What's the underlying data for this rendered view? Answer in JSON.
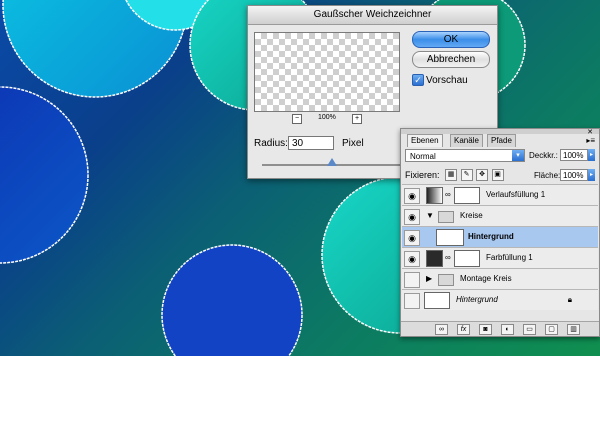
{
  "colors": {
    "accent": "#3b8ee8",
    "selected_row": "#a9c8f0"
  },
  "blur_dialog": {
    "title": "Gaußscher Weichzeichner",
    "ok_label": "OK",
    "cancel_label": "Abbrechen",
    "preview_label": "Vorschau",
    "preview_checked": true,
    "zoom_minus": "−",
    "zoom_plus": "+",
    "zoom_value": "100%",
    "radius_label": "Radius:",
    "radius_value": "30",
    "radius_unit": "Pixel",
    "slider_fraction": 0.32
  },
  "layers_panel": {
    "tabs": [
      {
        "label": "Ebenen",
        "active": true
      },
      {
        "label": "Kanäle",
        "active": false
      },
      {
        "label": "Pfade",
        "active": false
      }
    ],
    "blend_mode": "Normal",
    "opacity_label": "Deckkr.:",
    "opacity_value": "100%",
    "lock_label": "Fixieren:",
    "fill_label": "Fläche:",
    "fill_value": "100%",
    "layers": [
      {
        "name": "Verlaufsfüllung 1",
        "visible": true,
        "type": "gradient-fill"
      },
      {
        "name": "Kreise",
        "visible": true,
        "type": "group",
        "expanded": true
      },
      {
        "name": "Hintergrund",
        "visible": true,
        "type": "layer",
        "selected": true
      },
      {
        "name": "Farbfüllung 1",
        "visible": true,
        "type": "color-fill"
      },
      {
        "name": "Montage Kreis",
        "visible": false,
        "type": "group",
        "expanded": false
      },
      {
        "name": "Hintergrund",
        "visible": false,
        "type": "background",
        "locked": true
      }
    ],
    "footer_icons": [
      "link-icon",
      "fx-icon",
      "mask-icon",
      "adjustment-icon",
      "folder-icon",
      "new-layer-icon",
      "trash-icon"
    ]
  }
}
